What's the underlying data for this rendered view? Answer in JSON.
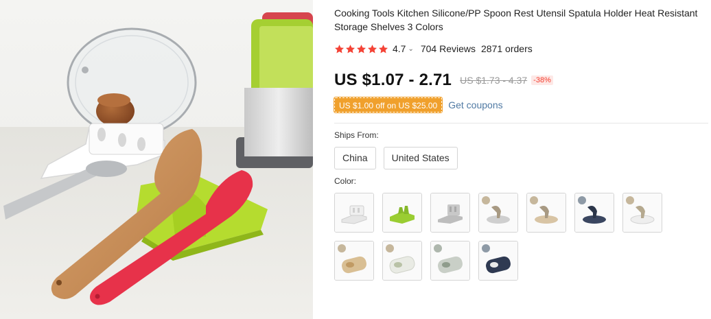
{
  "product": {
    "title": "Cooking Tools Kitchen Silicone/PP Spoon Rest Utensil Spatula Holder Heat Resistant Storage Shelves 3 Colors",
    "image": {
      "icon": "product-photo-spoon-rest"
    }
  },
  "rating": {
    "stars": 5,
    "value": "4.7",
    "reviews": "704 Reviews",
    "orders": "2871 orders",
    "star_color": "#f44336"
  },
  "price": {
    "current": "US $1.07 - 2.71",
    "original": "US $1.73 - 4.37",
    "discount": "-38%"
  },
  "coupon": {
    "badge": "US $1.00 off on US $25.00",
    "link": "Get coupons",
    "badge_color": "#f0a02c",
    "link_color": "#4f79a3"
  },
  "shipping": {
    "label": "Ships From:",
    "options": [
      "China",
      "United States"
    ]
  },
  "color": {
    "label": "Color:",
    "swatches": [
      {
        "name": "white-rest",
        "tint": "#e8e8e8"
      },
      {
        "name": "green-rest",
        "tint": "#9acd32"
      },
      {
        "name": "gray-rest",
        "tint": "#bdbdbd"
      },
      {
        "name": "gray-lid-stand",
        "tint": "#cfcfcf"
      },
      {
        "name": "khaki-lid-stand",
        "tint": "#d8c4a4"
      },
      {
        "name": "navy-lid-stand",
        "tint": "#3a4660"
      },
      {
        "name": "white-lid-stand",
        "tint": "#eeeeee"
      },
      {
        "name": "khaki-tray",
        "tint": "#d9bf94"
      },
      {
        "name": "white-tray",
        "tint": "#e9ebe4"
      },
      {
        "name": "gray-tray",
        "tint": "#c9cfc7"
      },
      {
        "name": "navy-tray",
        "tint": "#2f3a52"
      }
    ]
  }
}
